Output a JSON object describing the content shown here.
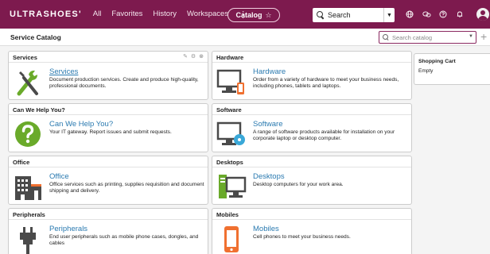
{
  "nav": {
    "logo": "ULTRASHOES'",
    "items": [
      "All",
      "Favorites",
      "History",
      "Workspaces"
    ],
    "kebab": "⋮",
    "catalog_label": "Catalog",
    "catalog_star": "☆",
    "search_value": "Search",
    "search_drop": "▼",
    "icons": [
      "globe-icon",
      "scripts-icon",
      "help-icon",
      "bell-icon"
    ]
  },
  "subheader": {
    "title": "Service Catalog",
    "search_placeholder": "Search catalog",
    "plus": "+"
  },
  "cart": {
    "title": "Shopping Cart",
    "status": "Empty"
  },
  "cards": [
    {
      "header": "Services",
      "title": "Services",
      "desc": "Document production services. Create and produce high-quality, professional documents.",
      "tools": "✎ ⚙ ⊗"
    },
    {
      "header": "Hardware",
      "title": "Hardware",
      "desc": "Order from a variety of hardware to meet your business needs, including phones, tablets and laptops."
    },
    {
      "header": "Can We Help You?",
      "title": "Can We Help You?",
      "desc": "Your IT gateway. Report issues and submit requests."
    },
    {
      "header": "Software",
      "title": "Software",
      "desc": "A range of software products available for installation on your corporate laptop or desktop computer."
    },
    {
      "header": "Office",
      "title": "Office",
      "desc": "Office services such as printing, supplies requisition and document shipping and delivery."
    },
    {
      "header": "Desktops",
      "title": "Desktops",
      "desc": "Desktop computers for your work area."
    },
    {
      "header": "Peripherals",
      "title": "Peripherals",
      "desc": "End user peripherals such as mobile phone cases, dongles, and cables"
    },
    {
      "header": "Mobiles",
      "title": "Mobiles",
      "desc": "Cell phones to meet your business needs."
    }
  ],
  "colors": {
    "nav_bg": "#7d1a4e",
    "link": "#2a7ab0",
    "help_green": "#6aaa2a",
    "icon_gray": "#4a4a4a",
    "accent_orange": "#f07030",
    "accent_blue": "#3aa8d8"
  }
}
